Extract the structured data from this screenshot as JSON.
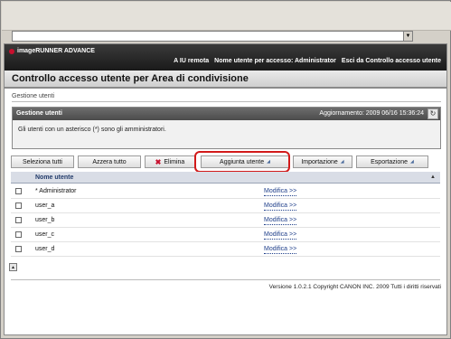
{
  "browser": {
    "address_dropdown_icon": "chevron-down-icon"
  },
  "brand": {
    "name": "imageRUNNER ADVANCE",
    "logo_color": "#c8102e"
  },
  "top_links": {
    "remote_ui": "A IU remota",
    "login_label": "Nome utente per accesso: Administrator",
    "logout": "Esci da Controllo accesso utente"
  },
  "page": {
    "title": "Controllo accesso utente per Area di condivisione",
    "breadcrumb": "Gestione utenti"
  },
  "panel": {
    "title": "Gestione utenti",
    "updated": "Aggiornamento: 2009 06/16 15:36:24",
    "note": "Gli utenti con un asterisco (*) sono gli amministratori."
  },
  "actions": {
    "select_all": "Seleziona tutti",
    "reset_all": "Azzera tutto",
    "delete": "Elimina",
    "add_user": "Aggiunta utente",
    "import": "Importazione",
    "export": "Esportazione"
  },
  "table": {
    "column_name": "Nome utente",
    "edit_label": "Modifica >>",
    "rows": [
      {
        "name": "* Administrator"
      },
      {
        "name": "user_a"
      },
      {
        "name": "user_b"
      },
      {
        "name": "user_c"
      },
      {
        "name": "user_d"
      }
    ]
  },
  "footer": {
    "copyright": "Versione 1.0.2.1 Copyright CANON INC. 2009 Tutti i diritti riservati"
  },
  "colors": {
    "highlight": "#d21a1a",
    "header_dark": "#1a1a1a",
    "link": "#1f3f8a"
  }
}
